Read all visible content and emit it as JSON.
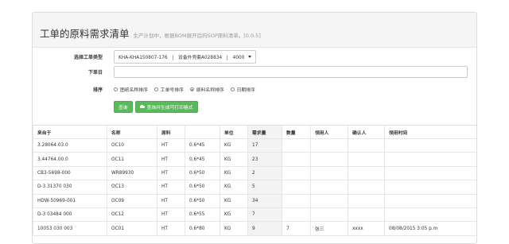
{
  "header": {
    "title": "工单的原料需求清单",
    "subtitle": "生产计划中，根据BOM展开后的SOP原料清单。[0.0.5]"
  },
  "form": {
    "order_type_label": "选择工单类型",
    "order_type_value": "KHA-KHA150807-176　|　设备外壳套A028834　|　4000",
    "order_date_label": "下单日",
    "order_date_value": "",
    "sort_label": "排序",
    "sort_options": [
      "图纸名称排序",
      "工单号排序",
      "原料名称排序",
      "日期排序"
    ],
    "sort_selected": "原料名称排序",
    "query_button": "查询",
    "print_button": "查询并生成可打印格式"
  },
  "table": {
    "columns": [
      "来自于",
      "名称",
      "原料",
      "",
      "单位",
      "需求量",
      "数量",
      "领用人",
      "确认人",
      "领用时间"
    ],
    "rows": [
      [
        "3.28064.03.0",
        "OC10",
        "HT",
        "0.6*45",
        "KG",
        "17",
        "",
        "",
        "",
        ""
      ],
      [
        "3.44764.00.0",
        "OC11",
        "HT",
        "0.6*45",
        "KG",
        "23",
        "",
        "",
        "",
        ""
      ],
      [
        "CB3-5698-000",
        "WR89930",
        "HT",
        "0.6*50",
        "KG",
        "2",
        "",
        "",
        "",
        ""
      ],
      [
        "D-3 31370 030",
        "OC13",
        "HT",
        "0.6*50",
        "KG",
        "5",
        "",
        "",
        "",
        ""
      ],
      [
        "HDW-50969-001",
        "OC09",
        "HT",
        "0.6*50",
        "KG",
        "34",
        "",
        "",
        "",
        ""
      ],
      [
        "D-3 03484 000",
        "OC12",
        "HT",
        "0.6*55",
        "KG",
        "7",
        "",
        "",
        "",
        ""
      ],
      [
        "10053 030 003",
        "OC01",
        "HT",
        "0.6*80",
        "KG",
        "9",
        "7",
        "张三",
        "xxxx",
        "08/08/2015 3:05 p.m"
      ]
    ]
  }
}
